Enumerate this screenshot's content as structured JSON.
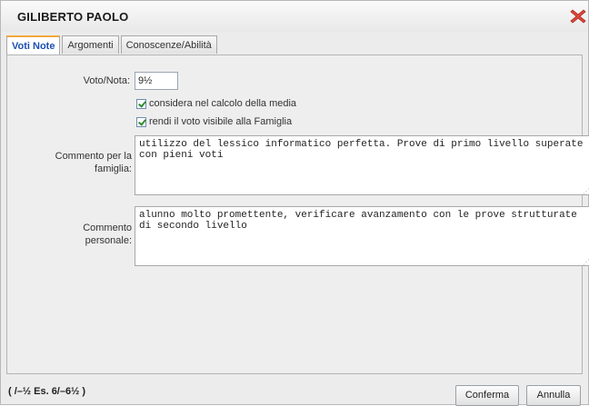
{
  "dialog": {
    "title": "GILIBERTO PAOLO",
    "close_icon": "close-icon",
    "close_color": "#d9483b"
  },
  "tabs": [
    {
      "label": "Voti Note",
      "active": true
    },
    {
      "label": "Argomenti",
      "active": false
    },
    {
      "label": "Conoscenze/Abilità",
      "active": false
    }
  ],
  "form": {
    "voto_label": "Voto/Nota:",
    "voto_value": "9½",
    "check_media_label": "considera nel calcolo della media",
    "check_media_checked": true,
    "check_famiglia_label": "rendi il voto visibile alla Famiglia",
    "check_famiglia_checked": true,
    "commento_famiglia_label_1": "Commento per la",
    "commento_famiglia_label_2": "famiglia:",
    "commento_famiglia_value": "utilizzo del lessico informatico perfetta. Prove di primo livello superate con pieni voti",
    "commento_personale_label_1": "Commento",
    "commento_personale_label_2": "personale:",
    "commento_personale_value": "alunno molto promettente, verificare avanzamento con le prove strutturate di secondo livello"
  },
  "footer": {
    "hint": "( /–½ Es. 6/–6½ )",
    "confirm_label": "Conferma",
    "cancel_label": "Annulla"
  }
}
